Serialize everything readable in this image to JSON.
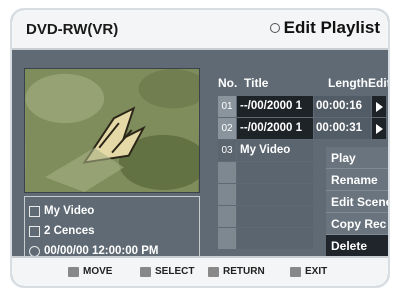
{
  "header": {
    "left_title": "DVD-RW(VR)",
    "right_title": "Edit Playlist",
    "right_icon": "circle-icon"
  },
  "info": {
    "title": "My Video",
    "scenes": "2 Cences",
    "datetime": "00/00/00 12:00:00  PM"
  },
  "table": {
    "headers": {
      "no": "No.",
      "title": "Title",
      "length": "Length",
      "edit": "Edit"
    },
    "rows": [
      {
        "no": "01",
        "title": "--/00/2000 1",
        "length": "00:00:16"
      },
      {
        "no": "02",
        "title": "--/00/2000 1",
        "length": "00:00:31"
      },
      {
        "no": "03",
        "title": "My Video",
        "length": ""
      }
    ]
  },
  "menu": {
    "items": [
      "Play",
      "Rename",
      "Edit Scene",
      "Copy Rec",
      "Delete"
    ],
    "selected_index": 4
  },
  "footer": {
    "move": "MOVE",
    "select": "SELECT",
    "return": "RETURN",
    "exit": "EXIT"
  },
  "colors": {
    "screen_bg": "#5f6a74",
    "highlight": "#1f252b",
    "header_bg": "#f4f5f6"
  }
}
